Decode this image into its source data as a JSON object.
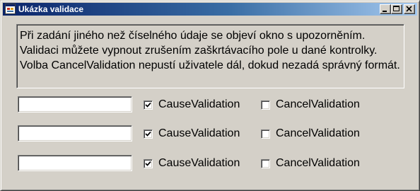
{
  "window": {
    "title": "Ukázka validace"
  },
  "info_text": "Při zadání jiného než číselného údaje se objeví okno s upozorněním. Validaci můžete vypnout zrušením zaškrtávacího pole u dané kontrolky. Volba CancelValidation nepustí uživatele dál, dokud nezadá správný formát.",
  "rows": [
    {
      "textbox_value": "",
      "cause_label": "CauseValidation",
      "cause_checked": true,
      "cancel_label": "CancelValidation",
      "cancel_checked": false
    },
    {
      "textbox_value": "",
      "cause_label": "CauseValidation",
      "cause_checked": true,
      "cancel_label": "CancelValidation",
      "cancel_checked": false
    },
    {
      "textbox_value": "",
      "cause_label": "CauseValidation",
      "cause_checked": true,
      "cancel_label": "CancelValidation",
      "cancel_checked": false
    }
  ],
  "colors": {
    "titlebar_start": "#0a246a",
    "titlebar_end": "#a6caf0",
    "face": "#d4d0c8"
  },
  "icons": {
    "app": "window-form-icon",
    "minimize": "minimize-icon",
    "maximize": "maximize-icon",
    "close": "close-icon",
    "check": "checkmark-icon"
  }
}
